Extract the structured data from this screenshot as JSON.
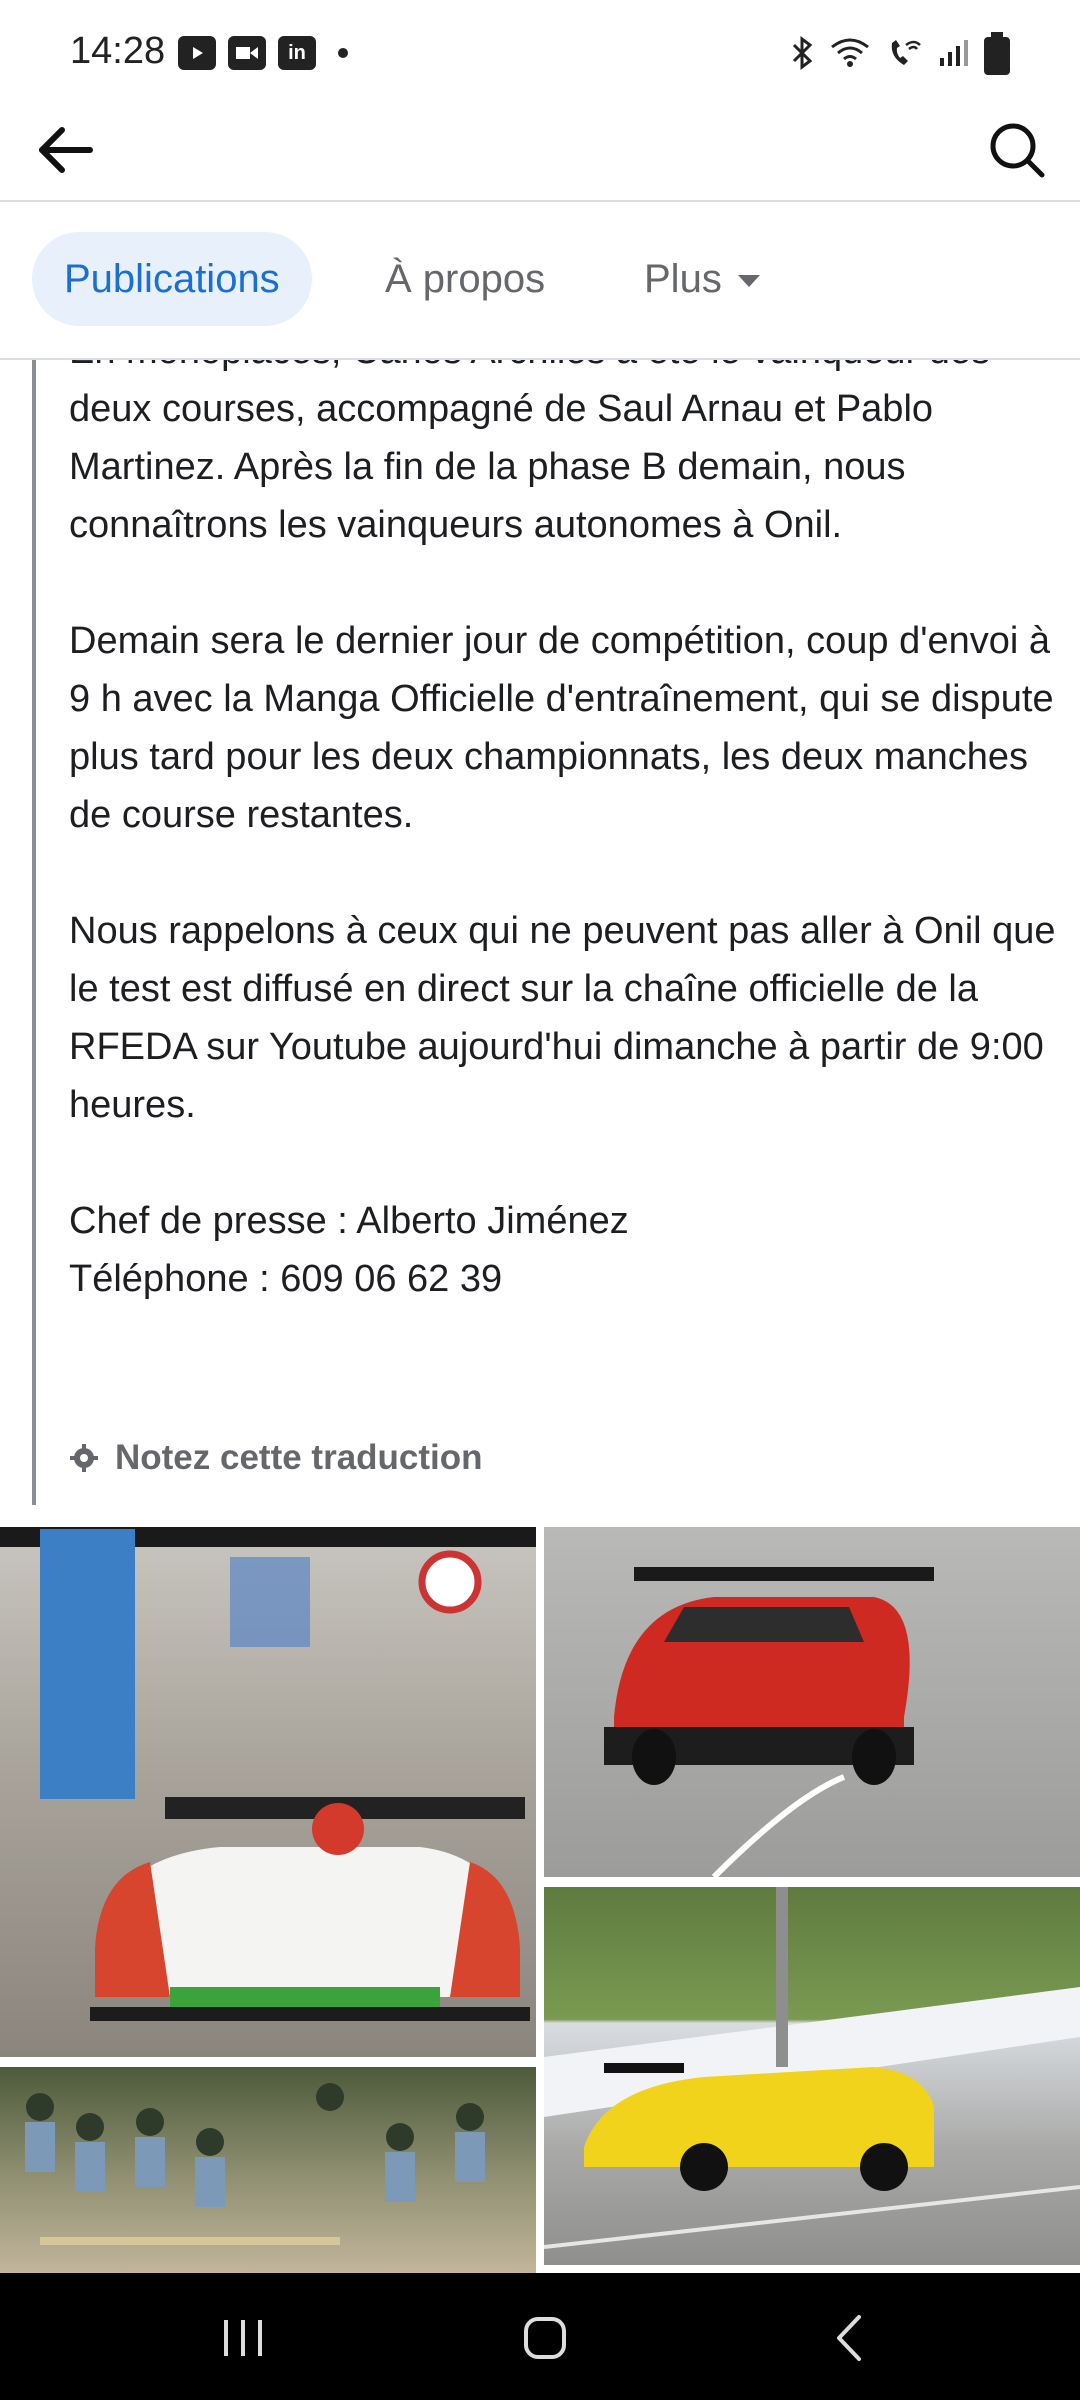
{
  "status_bar": {
    "time": "14:28",
    "left_icons": [
      "youtube-icon",
      "video-call-icon",
      "linkedin-icon",
      "notification-dot-icon"
    ],
    "right_icons": [
      "bluetooth-icon",
      "wifi-icon",
      "wifi-call-icon",
      "signal-icon",
      "battery-icon"
    ]
  },
  "top_bar": {
    "back_icon": "arrow-left-icon",
    "search_icon": "search-icon"
  },
  "tabs": [
    {
      "label": "Publications",
      "active": true
    },
    {
      "label": "À propos",
      "active": false
    },
    {
      "label": "Plus",
      "active": false,
      "icon": "caret-down-icon"
    }
  ],
  "post": {
    "paragraphs": [
      "En monoplaces, Carlos Archiles a été le vainqueur des deux courses, accompagné de Saul Arnau et Pablo Martinez. Après la fin de la phase B demain, nous connaîtrons les vainqueurs autonomes à Onil.",
      "Demain sera le dernier jour de compétition, coup d'envoi à 9 h avec la Manga Officielle d'entraînement, qui se dispute plus tard pour les deux championnats, les deux manches de course restantes.",
      "Nous rappelons à ceux qui ne peuvent pas aller à Onil que le test est diffusé en direct sur la chaîne officielle de la RFEDA sur Youtube aujourd'hui dimanche à partir de 9:00 heures."
    ],
    "press_chief": "Chef de presse : Alberto Jiménez",
    "phone": "Téléphone : 609 06 62 39",
    "translation_link": "Notez cette traduction",
    "accent_color": "#1b6fd1"
  },
  "photos": [
    {
      "subject": "red-white race prototype"
    },
    {
      "subject": "red Peugeot hillclimb car"
    },
    {
      "subject": "yellow race car"
    },
    {
      "subject": "spectators"
    }
  ],
  "nav_bar": {
    "recents_icon": "recents-icon",
    "home_icon": "home-icon",
    "back_icon": "chevron-left-icon"
  }
}
